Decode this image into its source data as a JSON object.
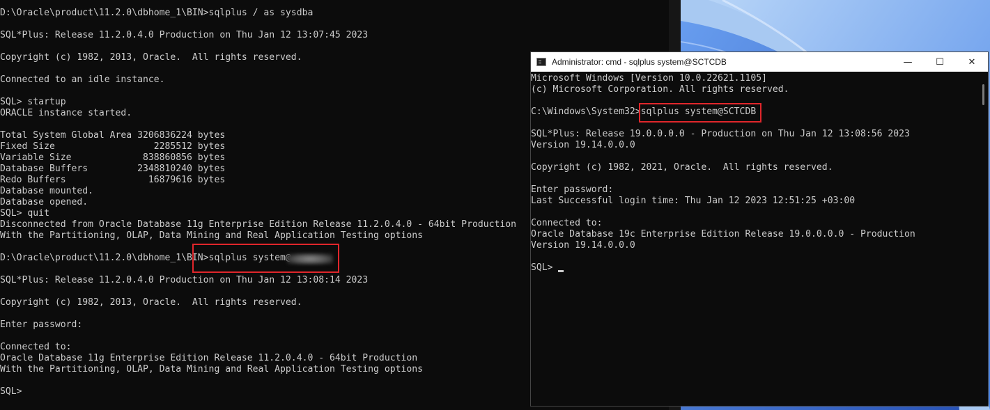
{
  "left_terminal": {
    "lines": [
      "D:\\Oracle\\product\\11.2.0\\dbhome_1\\BIN>sqlplus / as sysdba",
      "",
      "SQL*Plus: Release 11.2.0.4.0 Production on Thu Jan 12 13:07:45 2023",
      "",
      "Copyright (c) 1982, 2013, Oracle.  All rights reserved.",
      "",
      "Connected to an idle instance.",
      "",
      "SQL> startup",
      "ORACLE instance started.",
      "",
      "Total System Global Area 3206836224 bytes",
      "Fixed Size                  2285512 bytes",
      "Variable Size             838860856 bytes",
      "Database Buffers         2348810240 bytes",
      "Redo Buffers               16879616 bytes",
      "Database mounted.",
      "Database opened.",
      "SQL> quit",
      "Disconnected from Oracle Database 11g Enterprise Edition Release 11.2.0.4.0 - 64bit Production",
      "With the Partitioning, OLAP, Data Mining and Real Application Testing options",
      "",
      "D:\\Oracle\\product\\11.2.0\\dbhome_1\\BIN>sqlplus system@",
      "",
      "SQL*Plus: Release 11.2.0.4.0 Production on Thu Jan 12 13:08:14 2023",
      "",
      "Copyright (c) 1982, 2013, Oracle.  All rights reserved.",
      "",
      "Enter password:",
      "",
      "Connected to:",
      "Oracle Database 11g Enterprise Edition Release 11.2.0.4.0 - 64bit Production",
      "With the Partitioning, OLAP, Data Mining and Real Application Testing options",
      "",
      "SQL>"
    ]
  },
  "right_window": {
    "title": "Administrator: cmd - sqlplus  system@SCTCDB",
    "controls": {
      "minimize": "—",
      "maximize": "☐",
      "close": "✕"
    },
    "lines": [
      "Microsoft Windows [Version 10.0.22621.1105]",
      "(c) Microsoft Corporation. All rights reserved.",
      "",
      "C:\\Windows\\System32>sqlplus system@SCTCDB",
      "",
      "SQL*Plus: Release 19.0.0.0.0 - Production on Thu Jan 12 13:08:56 2023",
      "Version 19.14.0.0.0",
      "",
      "Copyright (c) 1982, 2021, Oracle.  All rights reserved.",
      "",
      "Enter password:",
      "Last Successful login time: Thu Jan 12 2023 12:51:25 +03:00",
      "",
      "Connected to:",
      "Oracle Database 19c Enterprise Edition Release 19.0.0.0.0 - Production",
      "Version 19.14.0.0.0",
      "",
      "SQL> "
    ]
  },
  "colors": {
    "terminal_bg": "#0c0c0c",
    "terminal_text": "#cccccc",
    "highlight": "#e0262b",
    "titlebar": "#ffffff"
  }
}
